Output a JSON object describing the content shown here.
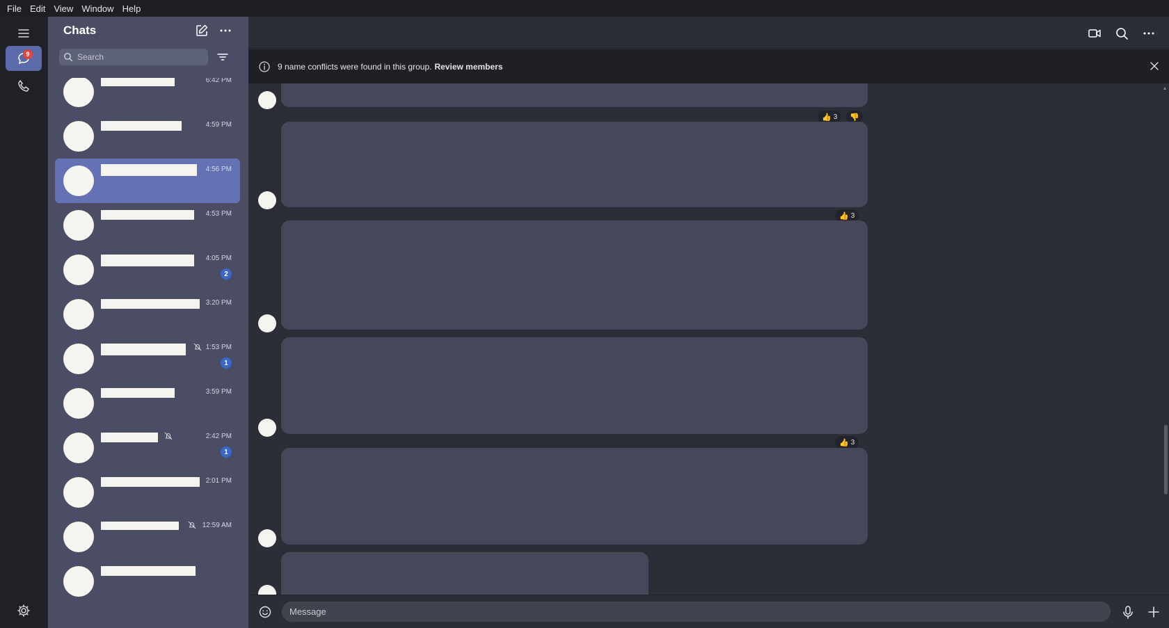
{
  "menu": [
    "File",
    "Edit",
    "View",
    "Window",
    "Help"
  ],
  "rail": {
    "chats_badge": "9",
    "icons": [
      "menu-icon",
      "chat-bubble-icon",
      "phone-icon",
      "gear-icon"
    ]
  },
  "chat_list": {
    "title": "Chats",
    "search_placeholder": "Search",
    "items": [
      {
        "time": "6:42 PM",
        "unread": "",
        "muted": false
      },
      {
        "time": "4:59 PM",
        "unread": "",
        "muted": false
      },
      {
        "time": "4:56 PM",
        "unread": "",
        "muted": false,
        "selected": true
      },
      {
        "time": "4:53 PM",
        "unread": "",
        "muted": false
      },
      {
        "time": "4:05 PM",
        "unread": "2",
        "muted": false
      },
      {
        "time": "3:20 PM",
        "unread": "",
        "muted": false
      },
      {
        "time": "1:53 PM",
        "unread": "1",
        "muted": true
      },
      {
        "time": "3:59 PM",
        "unread": "",
        "muted": false
      },
      {
        "time": "2:42 PM",
        "unread": "1",
        "muted": true
      },
      {
        "time": "2:01 PM",
        "unread": "",
        "muted": false
      },
      {
        "time": "12:59 AM",
        "unread": "",
        "muted": true
      },
      {
        "time": "",
        "unread": "",
        "muted": false
      }
    ]
  },
  "banner": {
    "text": "9 name conflicts were found in this group.",
    "link": "Review members"
  },
  "reactions": [
    {
      "items": [
        {
          "emoji": "👍",
          "count": "3"
        },
        {
          "emoji": "👎",
          "count": ""
        }
      ]
    },
    {
      "items": [
        {
          "emoji": "👍",
          "count": "3"
        }
      ]
    },
    {
      "items": [
        {
          "emoji": "👍",
          "count": "3"
        }
      ]
    }
  ],
  "composer": {
    "placeholder": "Message"
  },
  "colors": {
    "accent": "#5b6aa8",
    "selected_chat": "#6472b4",
    "badge_red": "#e0463d",
    "unread_blue": "#3a67c9",
    "bubble": "#464859"
  }
}
